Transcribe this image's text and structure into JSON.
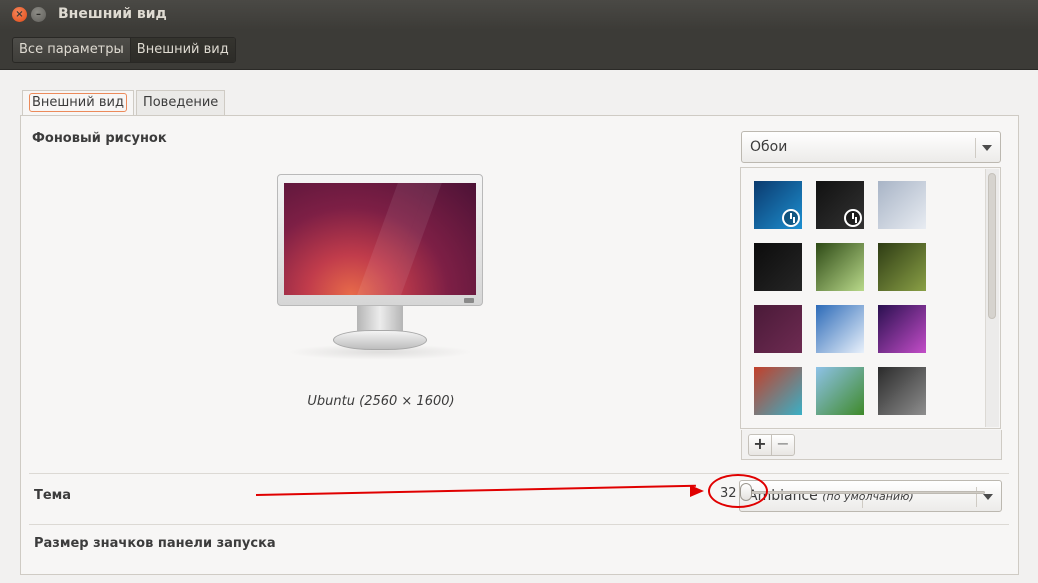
{
  "window": {
    "title": "Внешний вид",
    "close_glyph": "×",
    "minimize_glyph": "–"
  },
  "breadcrumb": {
    "items": [
      {
        "label": "Все параметры"
      },
      {
        "label": "Внешний вид"
      }
    ]
  },
  "tabs": [
    {
      "label": "Внешний вид",
      "active": true
    },
    {
      "label": "Поведение",
      "active": false
    }
  ],
  "background": {
    "section_label": "Фоновый рисунок",
    "caption": "Ubuntu (2560 × 1600)",
    "source_combo": {
      "value": "Обои"
    },
    "thumbnails": [
      {
        "name": "blue-timed",
        "icon": "clock-icon",
        "colors": [
          "#0b3a6e",
          "#1d8fd0"
        ]
      },
      {
        "name": "dark-timed",
        "icon": "clock-icon",
        "colors": [
          "#111111",
          "#333333"
        ]
      },
      {
        "name": "water-drop",
        "colors": [
          "#a8b4c6",
          "#e8ecf2"
        ]
      },
      {
        "name": "dark-room",
        "colors": [
          "#0c0c0c",
          "#262626"
        ]
      },
      {
        "name": "green-leaf",
        "colors": [
          "#2e4a16",
          "#b9d98a"
        ]
      },
      {
        "name": "green-grass",
        "colors": [
          "#2e3c14",
          "#8aa046"
        ]
      },
      {
        "name": "purple-moon",
        "colors": [
          "#4a1a38",
          "#6e2b52"
        ]
      },
      {
        "name": "mountains",
        "colors": [
          "#2d6bb8",
          "#e9f1fb"
        ]
      },
      {
        "name": "purple-sunset",
        "colors": [
          "#2a1050",
          "#c34dc8"
        ]
      },
      {
        "name": "colorful-stripes",
        "colors": [
          "#c33f2a",
          "#3ab0c6"
        ]
      },
      {
        "name": "tree",
        "colors": [
          "#8ec2e8",
          "#3f8a2a"
        ]
      },
      {
        "name": "dark-figure",
        "colors": [
          "#2b2b2b",
          "#8e8e8e"
        ]
      }
    ],
    "add_label": "+",
    "remove_label": "−"
  },
  "theme": {
    "section_label": "Тема",
    "value": "Ambiance",
    "value_note": "(по умолчанию)"
  },
  "launcher": {
    "section_label": "Размер значков панели запуска",
    "icon_size": "32",
    "icon_size_value": 32
  },
  "colors": {
    "accent": "#e95420",
    "annotation": "#e00000"
  }
}
